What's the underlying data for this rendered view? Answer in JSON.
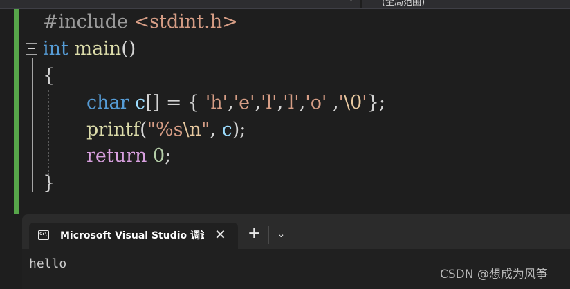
{
  "scope_bar": {
    "dropdown_arrow": "▾",
    "scope_label": "(全局范围)"
  },
  "editor": {
    "lines": [
      {
        "segments": [
          {
            "t": "#include ",
            "c": "pre"
          },
          {
            "t": "<stdint.h>",
            "c": "inc"
          }
        ]
      },
      {
        "segments": [
          {
            "t": "int",
            "c": "kw"
          },
          {
            "t": " ",
            "c": "pun"
          },
          {
            "t": "main",
            "c": "fn"
          },
          {
            "t": "()",
            "c": "pun"
          }
        ]
      },
      {
        "segments": [
          {
            "t": "{",
            "c": "pun"
          }
        ]
      },
      {
        "segments": []
      },
      {
        "segments": [
          {
            "t": "char",
            "c": "kw"
          },
          {
            "t": " ",
            "c": "pun"
          },
          {
            "t": "c",
            "c": "var"
          },
          {
            "t": "[] = { ",
            "c": "pun"
          },
          {
            "t": "'h'",
            "c": "str"
          },
          {
            "t": ",",
            "c": "pun"
          },
          {
            "t": "'e'",
            "c": "str"
          },
          {
            "t": ",",
            "c": "pun"
          },
          {
            "t": "'l'",
            "c": "str"
          },
          {
            "t": ",",
            "c": "pun"
          },
          {
            "t": "'l'",
            "c": "str"
          },
          {
            "t": ",",
            "c": "pun"
          },
          {
            "t": "'o' ",
            "c": "str"
          },
          {
            "t": ",",
            "c": "pun"
          },
          {
            "t": "'",
            "c": "str"
          },
          {
            "t": "\\0",
            "c": "esc"
          },
          {
            "t": "'",
            "c": "str"
          },
          {
            "t": "};",
            "c": "pun"
          }
        ]
      },
      {
        "segments": [
          {
            "t": "printf",
            "c": "fn"
          },
          {
            "t": "(",
            "c": "pun"
          },
          {
            "t": "\"%s",
            "c": "str"
          },
          {
            "t": "\\n",
            "c": "esc"
          },
          {
            "t": "\"",
            "c": "str"
          },
          {
            "t": ", ",
            "c": "pun"
          },
          {
            "t": "c",
            "c": "var"
          },
          {
            "t": ");",
            "c": "pun"
          }
        ]
      },
      {
        "segments": [
          {
            "t": "return",
            "c": "ctl"
          },
          {
            "t": " ",
            "c": "pun"
          },
          {
            "t": "0",
            "c": "num"
          },
          {
            "t": ";",
            "c": "pun"
          }
        ]
      },
      {
        "segments": [
          {
            "t": "}",
            "c": "pun"
          }
        ]
      }
    ]
  },
  "terminal": {
    "tab_icon_text": "C:\\",
    "tab_title": "Microsoft Visual Studio 调试控制台",
    "close_glyph": "✕",
    "add_glyph": "+",
    "dropdown_glyph": "⌄",
    "output_text": "hello"
  },
  "watermark": "CSDN @想成为风筝",
  "colors": {
    "editor_bg": "#1e1e1e",
    "change_bar": "#57a64a",
    "keyword": "#569cd6",
    "function": "#dcdcaa",
    "string": "#d69d85",
    "control": "#d8a0df",
    "number": "#b5cea8",
    "terminal_bg": "#202020",
    "tabstrip_bg": "#2b2b2b"
  }
}
